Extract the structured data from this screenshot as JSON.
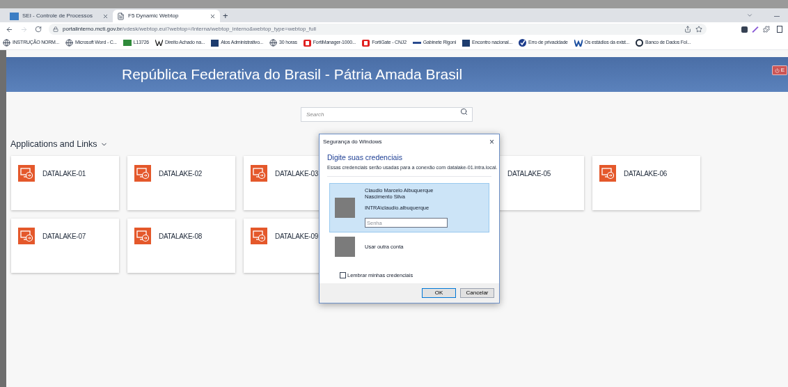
{
  "browser": {
    "tabs": [
      {
        "title": "SEI - Controle de Processos",
        "kind": "sei",
        "selected": false
      },
      {
        "title": "F5 Dynamic Webtop",
        "kind": "page",
        "selected": true
      }
    ],
    "new_tab": "+",
    "address": {
      "host": "portalinterno.mcti.gov.br",
      "path": "/vdesk/webtop.eui?webtop=/Interna/webtop_interno&webtop_type=webtop_full"
    },
    "bookmarks": [
      {
        "label": "INSTRUÇÃO NORM...",
        "kind": "globe"
      },
      {
        "label": "Microsoft Word - C...",
        "kind": "globe"
      },
      {
        "label": "L13726",
        "kind": "flag"
      },
      {
        "label": "Direito Achado na...",
        "kind": "w"
      },
      {
        "label": "Atos Administrativo...",
        "kind": "square"
      },
      {
        "label": "30 horas",
        "kind": "globe"
      },
      {
        "label": "FortiManager-1000...",
        "kind": "forti"
      },
      {
        "label": "FortiGate - CNJ2",
        "kind": "forti"
      },
      {
        "label": "Gabinete Rigoni",
        "kind": "dash"
      },
      {
        "label": "Encontro nacional...",
        "kind": "square"
      },
      {
        "label": "Erro de privacidade",
        "kind": "check"
      },
      {
        "label": "Os estádios da exist...",
        "kind": "people"
      },
      {
        "label": "Banco de Dados Fol...",
        "kind": "circle"
      }
    ]
  },
  "header": {
    "title": "República Federativa do Brasil - Pátria Amada Brasil",
    "logout": "E"
  },
  "search": {
    "placeholder": "Search"
  },
  "section": {
    "title": "Applications and Links"
  },
  "tile_rows": [
    [
      "DATALAKE-01",
      "DATALAKE-02",
      "DATALAKE-03",
      "DATALAKE-05",
      "DATALAKE-06"
    ],
    [
      "DATALAKE-07",
      "DATALAKE-08",
      "DATALAKE-09"
    ]
  ],
  "dialog": {
    "title": "Segurança do Windows",
    "close": "×",
    "heading": "Digite suas credenciais",
    "description": "Essas credenciais serão usadas para a conexão com datalake-01.intra.local.",
    "accounts": [
      {
        "name": "Claudio Marcelo Albuquerque Nascimento Silva",
        "user": "INTRA\\claudio.albuquerque",
        "password_placeholder": "Senha",
        "selected": true
      },
      {
        "name": "Usar outra conta",
        "selected": false
      }
    ],
    "remember": {
      "label": "Lembrar minhas credenciais",
      "checked": false
    },
    "buttons": [
      {
        "label": "OK",
        "primary": true
      },
      {
        "label": "Cancelar",
        "primary": false
      }
    ]
  }
}
